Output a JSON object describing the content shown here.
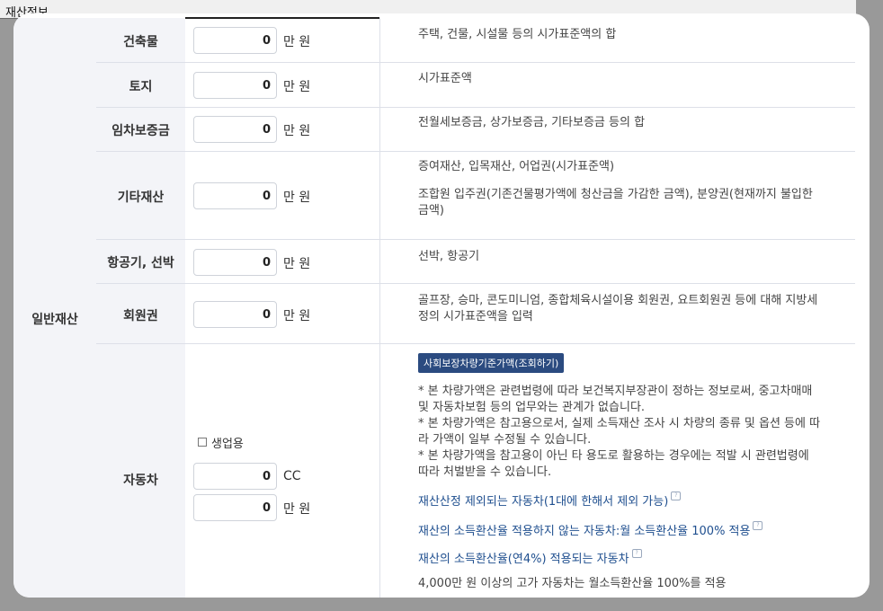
{
  "section": {
    "title": "재산정보"
  },
  "group": {
    "label": "일반재산"
  },
  "rows": [
    {
      "label": "건축물",
      "value": "0",
      "unit": "만 원",
      "desc": [
        "주택, 건물, 시설물 등의 시가표준액의 합"
      ]
    },
    {
      "label": "토지",
      "value": "0",
      "unit": "만 원",
      "desc": [
        "시가표준액"
      ]
    },
    {
      "label": "임차보증금",
      "value": "0",
      "unit": "만 원",
      "desc": [
        "전월세보증금, 상가보증금, 기타보증금 등의 합"
      ]
    },
    {
      "label": "기타재산",
      "value": "0",
      "unit": "만 원",
      "desc": [
        "증여재산, 입목재산, 어업권(시가표준액)",
        "조합원 입주권(기존건물평가액에 청산금을 가감한 금액), 분양권(현재까지 불입한",
        "금액)"
      ]
    },
    {
      "label": "항공기, 선박",
      "value": "0",
      "unit": "만 원",
      "desc": [
        "선박, 항공기"
      ]
    },
    {
      "label": "회원권",
      "value": "0",
      "unit": "만 원",
      "desc": [
        "골프장, 승마, 콘도미니엄, 종합체육시설이용 회원권, 요트회원권 등에 대해 지방세",
        "정의 시가표준액을 입력"
      ]
    }
  ],
  "car": {
    "label": "자동차",
    "business_use_label": "생업용",
    "business_use_checked": false,
    "cc_value": "0",
    "cc_unit": "CC",
    "price_value": "0",
    "price_unit": "만 원",
    "lookup_button": "사회보장차량기준가액(조회하기)",
    "notes": [
      "* 본 차량가액은 관련법령에 따라 보건복지부장관이 정하는 정보로써, 중고차매매",
      "및 자동차보험 등의 업무와는 관계가 없습니다.",
      "* 본 차량가액은 참고용으로서, 실제 소득재산 조사 시 차량의 종류 및 옵션 등에 따",
      "라 가액이 일부 수정될 수 있습니다.",
      "* 본 차량가액을 참고용이 아닌 타 용도로 활용하는 경우에는 적발 시 관련법령에",
      "따라 처벌받을 수 있습니다."
    ],
    "links": [
      "재산산정 제외되는 자동차(1대에 한해서 제외 가능)",
      "재산의 소득환산율 적용하지 않는 자동차:월 소득환산율 100% 적용",
      "재산의 소득환산율(연4%) 적용되는 자동차"
    ],
    "footer_note": "4,000만 원 이상의 고가 자동차는 월소득환산율 100%를 적용"
  }
}
